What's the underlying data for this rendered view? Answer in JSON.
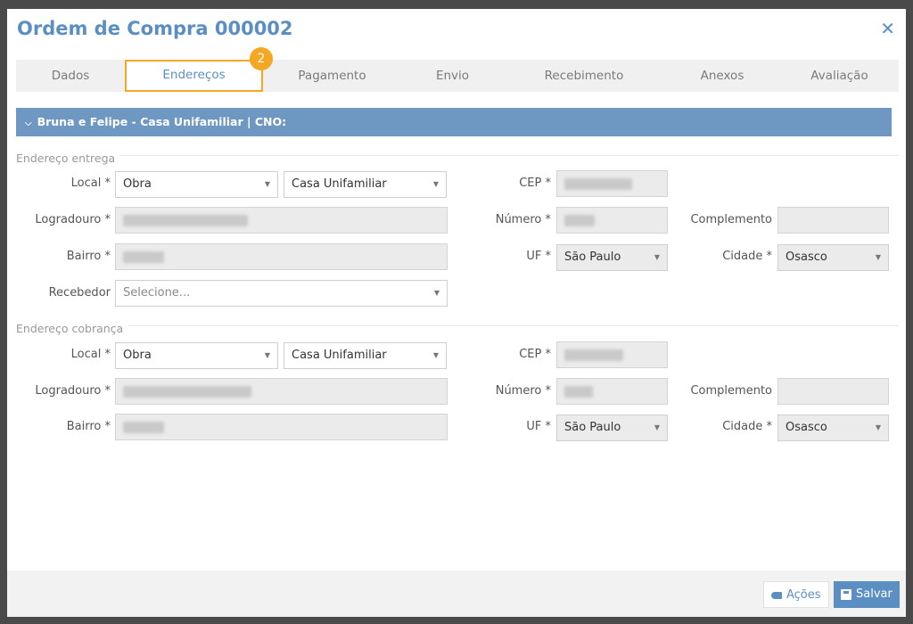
{
  "modal": {
    "title": "Ordem de Compra 000002",
    "close_glyph": "✕",
    "step_badge": "2"
  },
  "tabs": [
    {
      "label": "Dados",
      "active": false
    },
    {
      "label": "Endereços",
      "active": true
    },
    {
      "label": "Pagamento",
      "active": false
    },
    {
      "label": "Envio",
      "active": false
    },
    {
      "label": "Recebimento",
      "active": false
    },
    {
      "label": "Anexos",
      "active": false
    },
    {
      "label": "Avaliação",
      "active": false
    }
  ],
  "section": {
    "title": "Bruna e Felipe - Casa Unifamiliar | CNO:"
  },
  "delivery": {
    "group_label": "Endereço entrega",
    "local_label": "Local *",
    "local_value": "Obra",
    "local_sub_value": "Casa Unifamiliar",
    "cep_label": "CEP *",
    "logradouro_label": "Logradouro *",
    "numero_label": "Número *",
    "complemento_label": "Complemento",
    "bairro_label": "Bairro *",
    "uf_label": "UF *",
    "uf_value": "São Paulo",
    "cidade_label": "Cidade *",
    "cidade_value": "Osasco",
    "recebedor_label": "Recebedor",
    "recebedor_placeholder": "Selecione..."
  },
  "billing": {
    "group_label": "Endereço cobrança",
    "local_label": "Local *",
    "local_value": "Obra",
    "local_sub_value": "Casa Unifamiliar",
    "cep_label": "CEP *",
    "logradouro_label": "Logradouro *",
    "numero_label": "Número *",
    "complemento_label": "Complemento",
    "bairro_label": "Bairro *",
    "uf_label": "UF *",
    "uf_value": "São Paulo",
    "cidade_label": "Cidade *",
    "cidade_value": "Osasco"
  },
  "footer": {
    "acoes_label": "Ações",
    "salvar_label": "Salvar"
  },
  "colors": {
    "accent": "#5b8fc4",
    "highlight": "#f5a623",
    "section_bar": "#6e98c2"
  }
}
